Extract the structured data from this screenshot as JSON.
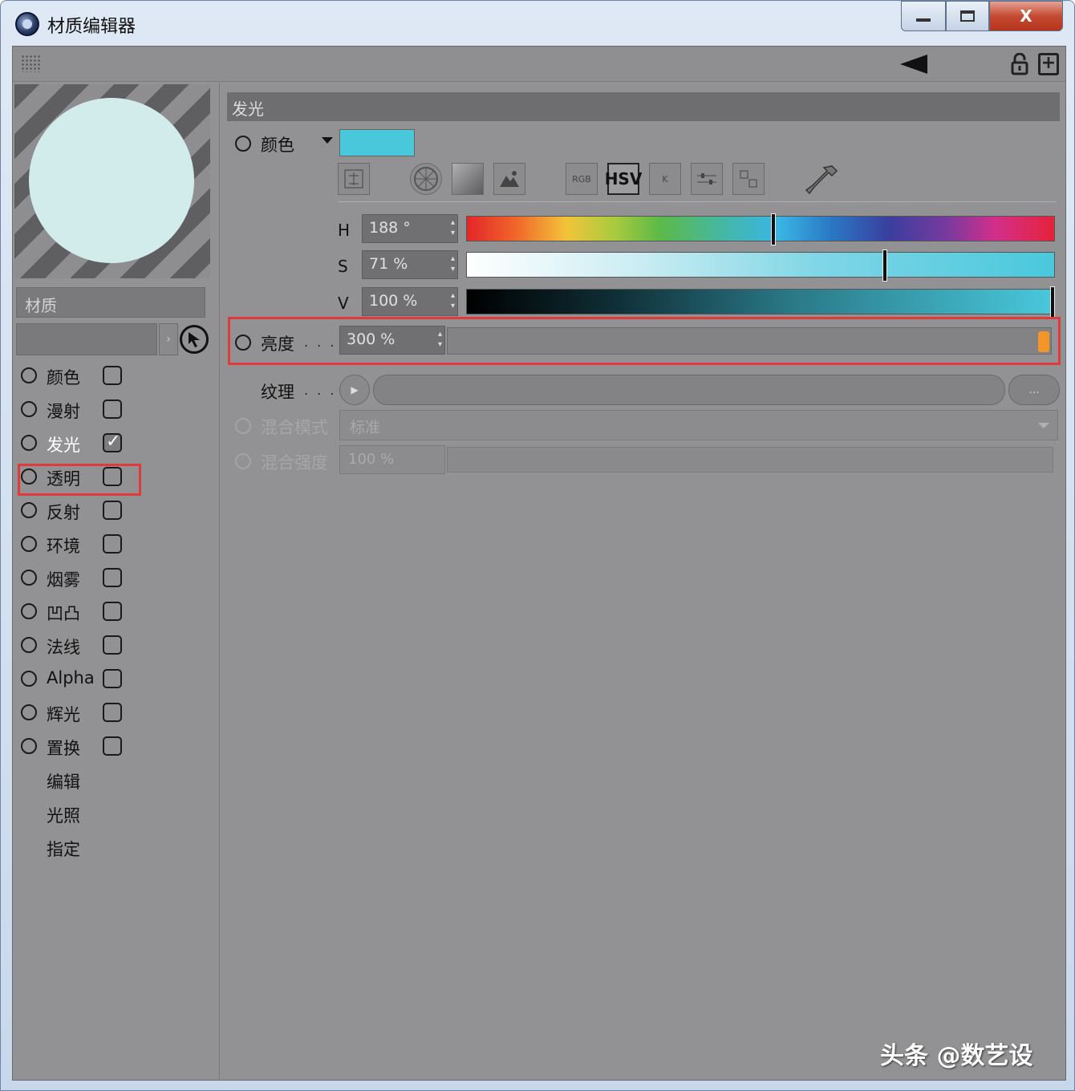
{
  "window": {
    "title": "材质编辑器",
    "minimize_icon": "minimize-icon",
    "maximize_icon": "maximize-icon",
    "close_label": "X"
  },
  "left": {
    "material_label": "材质",
    "channels": [
      {
        "label": "颜色",
        "checked": false
      },
      {
        "label": "漫射",
        "checked": false
      },
      {
        "label": "发光",
        "checked": true
      },
      {
        "label": "透明",
        "checked": false
      },
      {
        "label": "反射",
        "checked": false
      },
      {
        "label": "环境",
        "checked": false
      },
      {
        "label": "烟雾",
        "checked": false
      },
      {
        "label": "凹凸",
        "checked": false
      },
      {
        "label": "法线",
        "checked": false
      },
      {
        "label": "Alpha",
        "checked": false
      },
      {
        "label": "辉光",
        "checked": false
      },
      {
        "label": "置换",
        "checked": false
      }
    ],
    "extras": [
      "编辑",
      "光照",
      "指定"
    ]
  },
  "main": {
    "section": "发光",
    "color_label": "颜色",
    "color_swatch": "#49c8dc",
    "mode_buttons": [
      "RGB",
      "HSV",
      "K"
    ],
    "selected_mode": "HSV",
    "h": {
      "letter": "H",
      "value": "188 °",
      "fraction": 0.52
    },
    "s": {
      "letter": "S",
      "value": "71 %",
      "fraction": 0.71
    },
    "v": {
      "letter": "V",
      "value": "100 %",
      "fraction": 1.0
    },
    "brightness_label": "亮度",
    "brightness_value": "300 %",
    "dots": ". . .",
    "texture_label": "纹理",
    "texture_more": "...",
    "blend_mode_label": "混合模式",
    "blend_mode_value": "标准",
    "blend_strength_label": "混合强度",
    "blend_strength_value": "100 %"
  },
  "watermark": "头条 @数艺设",
  "colors": {
    "highlight": "#e03a3a",
    "knob": "#f2962a",
    "panel": "#929294"
  }
}
